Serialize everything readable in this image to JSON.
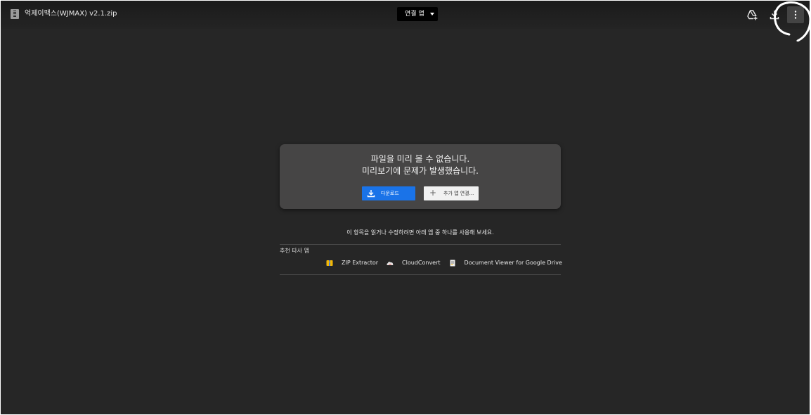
{
  "header": {
    "file_title": "억제이맥스(WJMAX) v2.1.zip",
    "open_with_label": "연결 앱",
    "icons": [
      "add-to-drive-icon",
      "download-icon",
      "more-vert-icon"
    ]
  },
  "error": {
    "line1": "파일을 미리 볼 수 없습니다.",
    "line2": "미리보기에 문제가 발생했습니다.",
    "download_label": "다운로드",
    "more_apps_label": "추가 앱 연결...",
    "more_apps_icon": "plus-icon"
  },
  "suggestions": {
    "helper_text": "이 항목을 읽거나 수정하려면 아래 앱 중 하나를 사용해 보세요.",
    "section_label": "추천 타사 앱",
    "apps": [
      {
        "label": "ZIP Extractor",
        "icon": "zip-extractor-icon"
      },
      {
        "label": "CloudConvert",
        "icon": "cloudconvert-icon"
      },
      {
        "label": "Document Viewer for Google Drive",
        "icon": "document-viewer-icon"
      }
    ]
  },
  "colors": {
    "background": "#262626",
    "card": "#464545",
    "accent": "#1a73e8",
    "annotation": "#ffffff"
  }
}
